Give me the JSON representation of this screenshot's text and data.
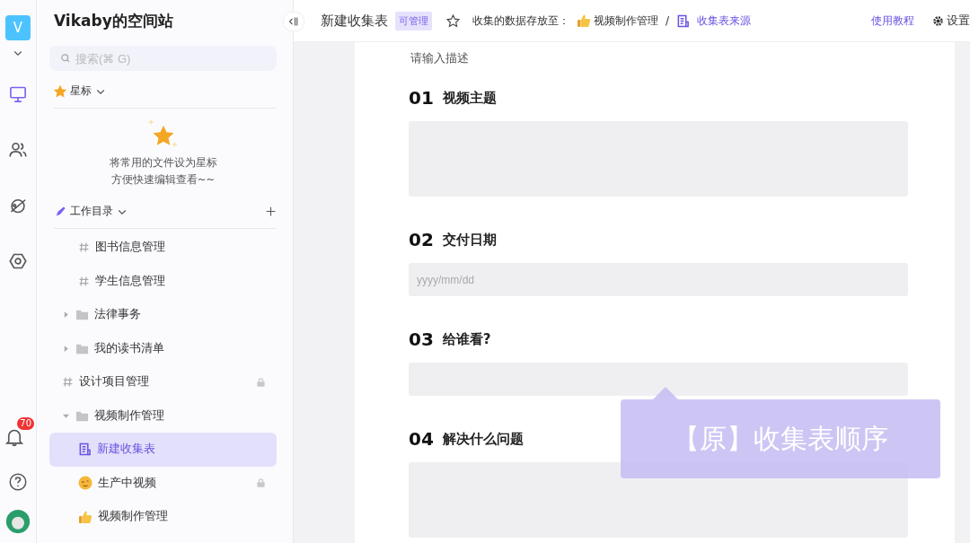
{
  "rail": {
    "space_initial": "V",
    "nav": [
      {
        "selected": true
      },
      {
        "selected": false
      },
      {
        "selected": false
      },
      {
        "selected": false
      }
    ],
    "notifications": "70"
  },
  "sidebar": {
    "title": "Vikaby的空间站",
    "search": {
      "placeholder": "搜索(⌘ G)"
    },
    "starred": {
      "label": "星标",
      "expanded": true,
      "empty_text": [
        "将常用的文件设为星标",
        "方便快速编辑查看~~"
      ]
    },
    "workdir": {
      "label": "工作目录",
      "expanded": true
    },
    "tree": [
      {
        "kind": "group",
        "children": [
          {
            "kind": "datasheet",
            "label": "图书信息管理",
            "locked": false,
            "selected": false
          },
          {
            "kind": "datasheet",
            "label": "学生信息管理",
            "locked": false,
            "selected": false
          }
        ]
      },
      {
        "kind": "folder",
        "label": "法律事务",
        "expanded": false,
        "locked": false,
        "selected": false
      },
      {
        "kind": "folder",
        "label": "我的读书清单",
        "expanded": false,
        "locked": false,
        "selected": false
      },
      {
        "kind": "datasheet",
        "label": "设计项目管理",
        "locked": true,
        "selected": false
      },
      {
        "kind": "folder",
        "label": "视频制作管理",
        "expanded": true,
        "locked": false,
        "selected": false,
        "children": [
          {
            "kind": "form",
            "label": "新建收集表",
            "locked": false,
            "selected": true
          },
          {
            "kind": "wink",
            "label": "生产中视频",
            "locked": true,
            "selected": false
          },
          {
            "kind": "thumb",
            "label": "视频制作管理",
            "locked": false,
            "selected": false
          }
        ]
      }
    ]
  },
  "header": {
    "title": "新建收集表",
    "permission": "可管理",
    "starred": false,
    "storage_label": "收集的数据存放至：",
    "path": [
      {
        "kind": "thumb",
        "label": "视频制作管理"
      },
      {
        "kind": "datasheet",
        "label": "收集表来源"
      }
    ],
    "separator": "/",
    "tutorial": "使用教程",
    "settings": "设置"
  },
  "form": {
    "description_placeholder": "请输入描述",
    "questions": [
      {
        "number": "01",
        "title": "视频主题",
        "kind": "textarea"
      },
      {
        "number": "02",
        "title": "交付日期",
        "kind": "date",
        "placeholder": "yyyy/mm/dd"
      },
      {
        "number": "03",
        "title": "给谁看?",
        "kind": "text"
      },
      {
        "number": "04",
        "title": "解决什么问题",
        "kind": "textarea"
      }
    ]
  },
  "caption": "【原】收集表顺序"
}
